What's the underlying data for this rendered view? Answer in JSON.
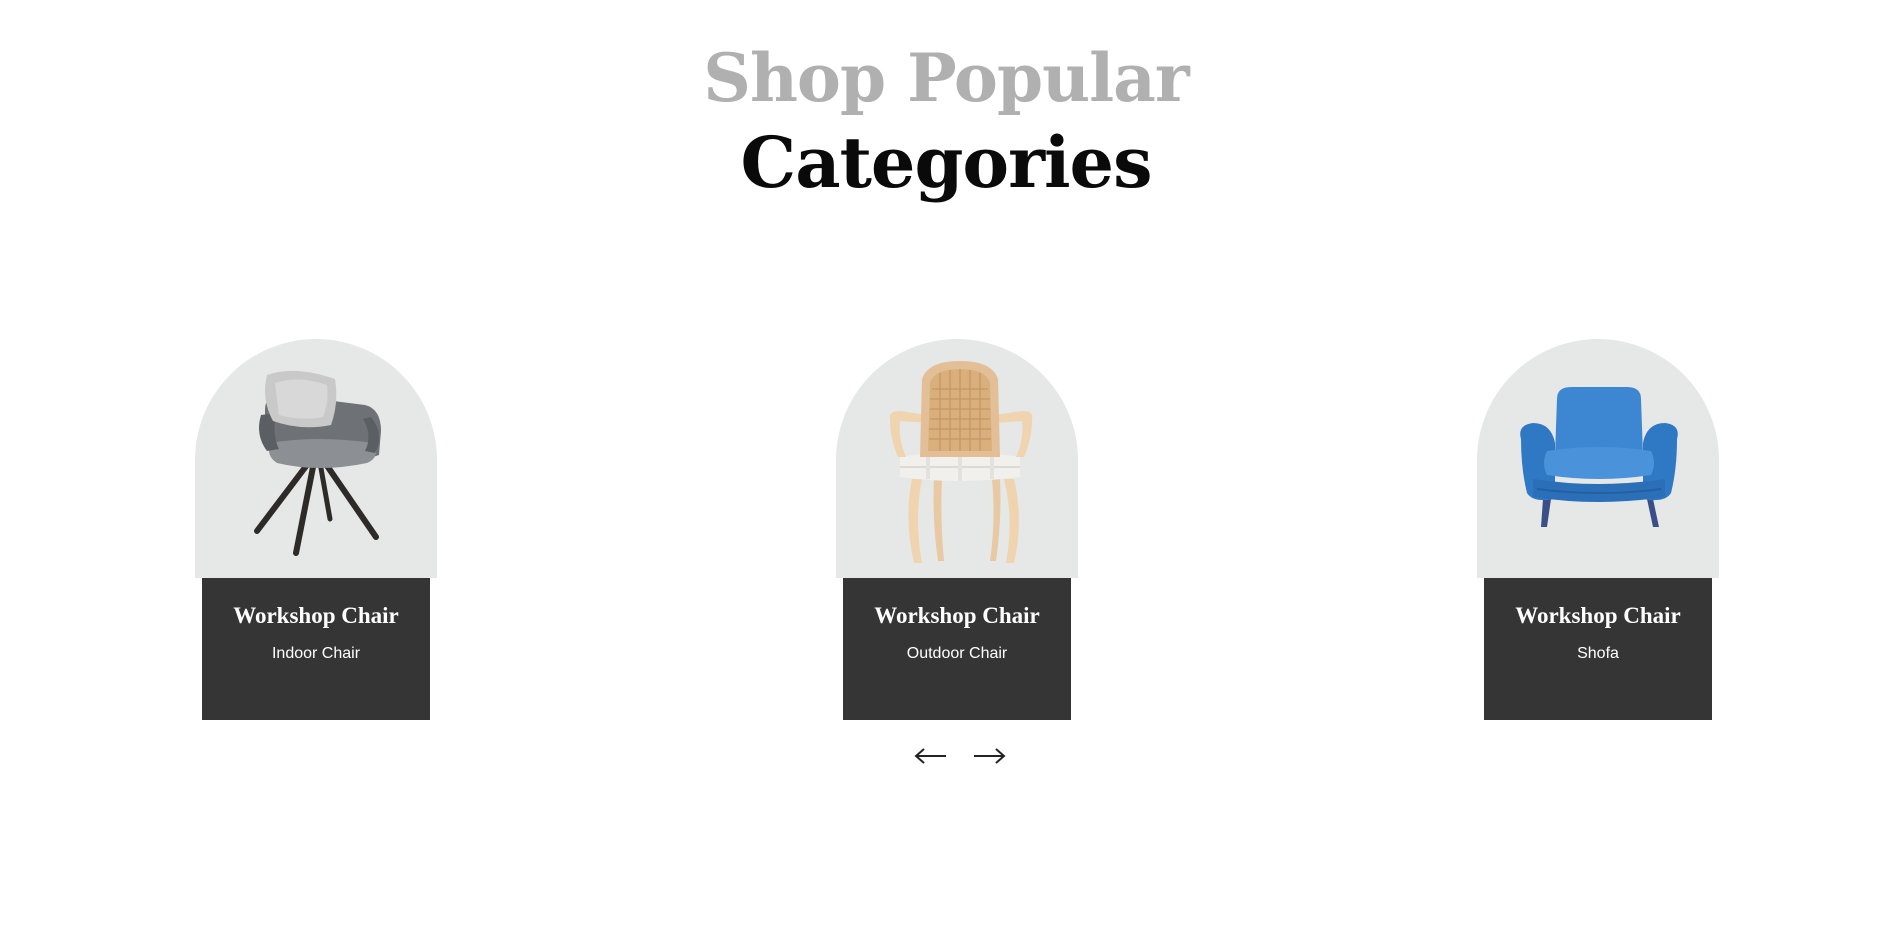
{
  "heading": {
    "line1": "Shop Popular",
    "line2": "Categories"
  },
  "cards": [
    {
      "title": "Workshop Chair",
      "subtitle": "Indoor Chair",
      "image": "gray-swivel-chair-image"
    },
    {
      "title": "Workshop Chair",
      "subtitle": "Outdoor Chair",
      "image": "cane-wooden-chair-image"
    },
    {
      "title": "Workshop Chair",
      "subtitle": "Shofa",
      "image": "blue-armchair-image"
    }
  ],
  "nav": {
    "prev_icon": "arrow-left-icon",
    "next_icon": "arrow-right-icon"
  },
  "colors": {
    "heading_muted": "#b0b0b0",
    "heading_dark": "#0a0a0a",
    "card_bg": "#e5e8e6",
    "caption_bg": "#353535"
  }
}
